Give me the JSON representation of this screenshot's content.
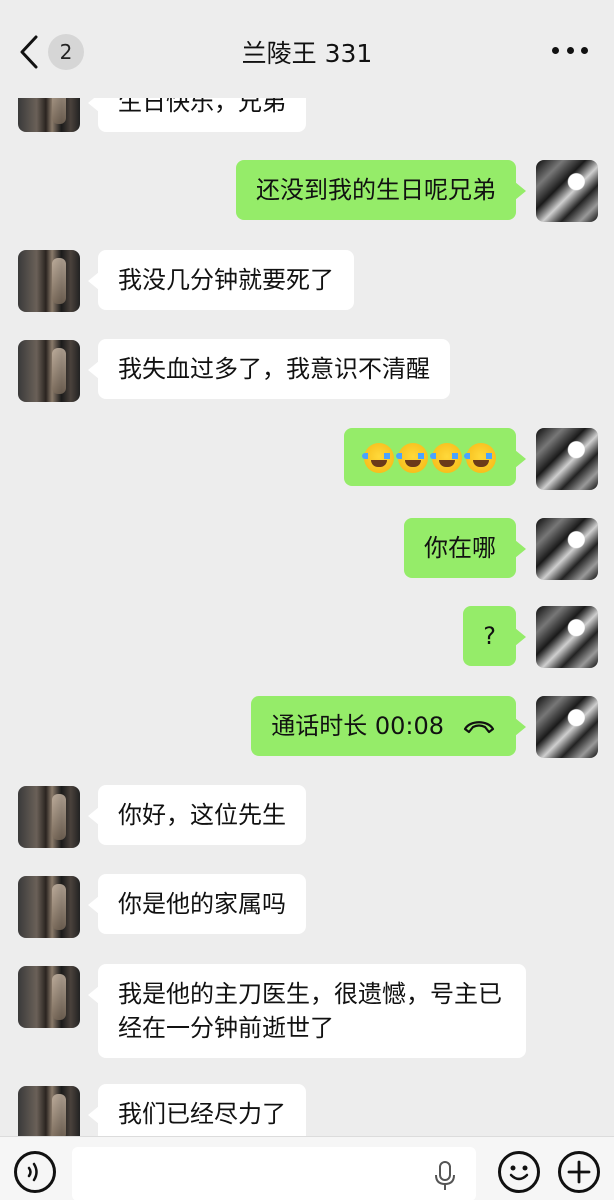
{
  "header": {
    "back_badge": "2",
    "title": "兰陵王 331"
  },
  "messages": [
    {
      "from": "peer",
      "text": "生日快乐，兄弟"
    },
    {
      "from": "me",
      "text": "还没到我的生日呢兄弟"
    },
    {
      "from": "peer",
      "text": "我没几分钟就要死了"
    },
    {
      "from": "peer",
      "text": "我失血过多了，我意识不清醒"
    },
    {
      "from": "me",
      "type": "emoji",
      "emoji": "face-with-tears-of-joy",
      "count": 4
    },
    {
      "from": "me",
      "text": "你在哪"
    },
    {
      "from": "me",
      "text": "?"
    },
    {
      "from": "me",
      "type": "call",
      "text": "通话时长 00:08"
    },
    {
      "from": "peer",
      "text": "你好，这位先生"
    },
    {
      "from": "peer",
      "text": "你是他的家属吗"
    },
    {
      "from": "peer",
      "text": "我是他的主刀医生，很遗憾，号主已经在一分钟前逝世了"
    },
    {
      "from": "peer",
      "text": "我们已经尽力了"
    }
  ],
  "colors": {
    "background": "#ededed",
    "my_bubble": "#95ec69",
    "peer_bubble": "#ffffff"
  }
}
